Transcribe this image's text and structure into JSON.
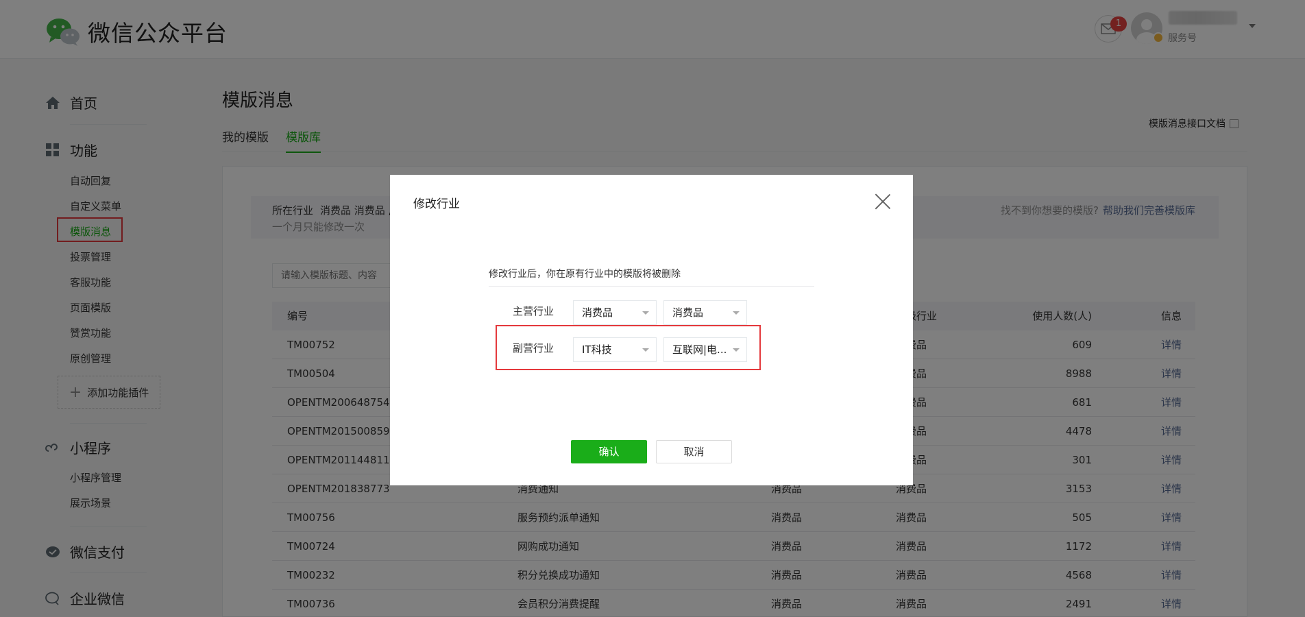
{
  "header": {
    "logo_text": "微信公众平台",
    "mail_count": "1",
    "account_type": "服务号"
  },
  "sidebar": {
    "home": "首页",
    "features": "功能",
    "feature_items": [
      "自动回复",
      "自定义菜单",
      "模版消息",
      "投票管理",
      "客服功能",
      "页面模版",
      "赞赏功能",
      "原创管理"
    ],
    "add_plugin": "添加功能插件",
    "miniprogram": "小程序",
    "miniprogram_items": [
      "小程序管理",
      "展示场景"
    ],
    "pay": "微信支付",
    "work": "企业微信"
  },
  "main": {
    "title": "模版消息",
    "tabs": [
      "我的模版",
      "模版库"
    ],
    "doc_link": "模版消息接口文档",
    "industry_label": "所在行业",
    "industry_value": "消费品 消费品 ,",
    "industry_note": "一个月只能修改一次",
    "help_text": "找不到你想要的模版?",
    "help_link": "帮助我们完善模版库",
    "search_placeholder": "请输入模版标题、内容",
    "table_headers": {
      "id": "编号",
      "ind2": "二级行业",
      "users": "使用人数(人)",
      "info": "信息"
    },
    "rows": [
      {
        "id": "TM00752",
        "title": "",
        "ind1": "",
        "ind2": "消费品",
        "users": "609",
        "info": "详情"
      },
      {
        "id": "TM00504",
        "title": "",
        "ind1": "",
        "ind2": "消费品",
        "users": "8988",
        "info": "详情"
      },
      {
        "id": "OPENTM200648754",
        "title": "",
        "ind1": "",
        "ind2": "消费品",
        "users": "681",
        "info": "详情"
      },
      {
        "id": "OPENTM201500859",
        "title": "",
        "ind1": "",
        "ind2": "消费品",
        "users": "4478",
        "info": "详情"
      },
      {
        "id": "OPENTM201144811",
        "title": "",
        "ind1": "",
        "ind2": "消费品",
        "users": "301",
        "info": "详情"
      },
      {
        "id": "OPENTM201838773",
        "title": "消费通知",
        "ind1": "消费品",
        "ind2": "消费品",
        "users": "3153",
        "info": "详情"
      },
      {
        "id": "TM00756",
        "title": "服务预约派单通知",
        "ind1": "消费品",
        "ind2": "消费品",
        "users": "505",
        "info": "详情"
      },
      {
        "id": "TM00724",
        "title": "网购成功通知",
        "ind1": "消费品",
        "ind2": "消费品",
        "users": "1172",
        "info": "详情"
      },
      {
        "id": "TM00232",
        "title": "积分兑换成功通知",
        "ind1": "消费品",
        "ind2": "消费品",
        "users": "4568",
        "info": "详情"
      },
      {
        "id": "TM00736",
        "title": "会员积分消费提醒",
        "ind1": "消费品",
        "ind2": "消费品",
        "users": "2491",
        "info": "详情"
      }
    ]
  },
  "dialog": {
    "title": "修改行业",
    "note": "修改行业后，你在原有行业中的模版将被删除",
    "primary_label": "主营行业",
    "primary_1": "消费品",
    "primary_2": "消费品",
    "secondary_label": "副营行业",
    "secondary_1": "IT科技",
    "secondary_2": "互联网|电...",
    "ok": "确认",
    "cancel": "取消"
  },
  "colors": {
    "accent": "#1aad19",
    "highlight": "#e4393c",
    "link": "#576b95"
  }
}
